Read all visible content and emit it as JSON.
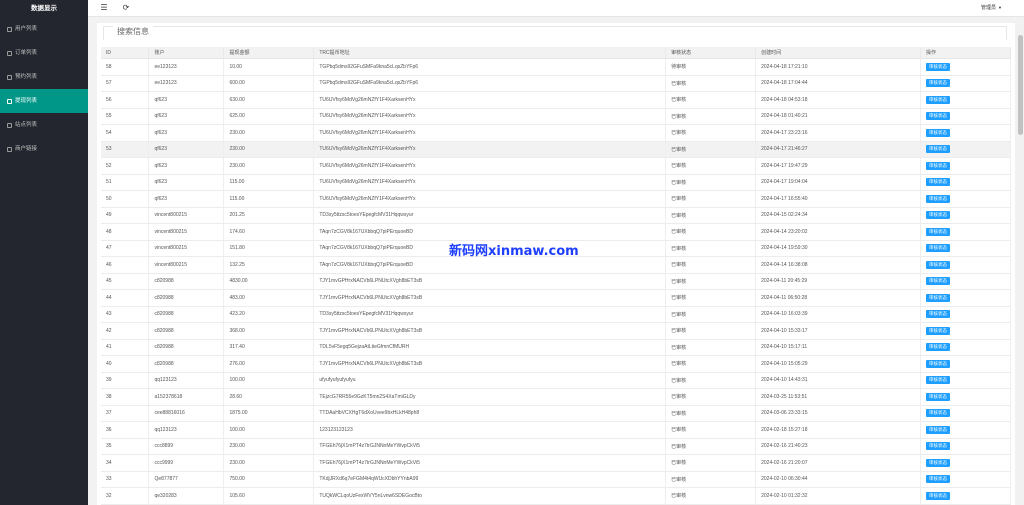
{
  "sidebar": {
    "brand": "数据显示",
    "items": [
      {
        "label": "用户列表",
        "active": false
      },
      {
        "label": "订单列表",
        "active": false
      },
      {
        "label": "预约列表",
        "active": false
      },
      {
        "label": "提现列表",
        "active": true
      },
      {
        "label": "站点列表",
        "active": false
      },
      {
        "label": "商户链接",
        "active": false
      }
    ]
  },
  "header": {
    "menu_icon": "menu-icon",
    "refresh_icon": "refresh-icon",
    "user_label": "管理员",
    "caret": "▼"
  },
  "search": {
    "title": "搜索信息"
  },
  "table": {
    "columns": [
      "ID",
      "账户",
      "提现金额",
      "TRC提币地址",
      "审核状态",
      "创建时间",
      "操作"
    ],
    "action_label": "审核状态",
    "rows": [
      [
        "58",
        "ee123123",
        "10.00",
        "TGPbq5dms92GFuSMFa9kna5cLqsZbYFp6",
        "待审核",
        "2024-04-18 17:21:10"
      ],
      [
        "57",
        "ee123123",
        "600.00",
        "TGPbq5dms92GFuSMFa9kna5cLqsZbYFp6",
        "已审核",
        "2024-04-18 17:04:44"
      ],
      [
        "56",
        "qf623",
        "630.00",
        "TU6UVfsy6MdVg26mNZfY1F4XarksenHYx",
        "已审核",
        "2024-04-18 04:53:18"
      ],
      [
        "55",
        "qf623",
        "625.00",
        "TU6UVfsy6MdVg26mNZfY1F4XarksenHYx",
        "已审核",
        "2024-04-18 01:40:21"
      ],
      [
        "54",
        "qf623",
        "230.00",
        "TU6UVfsy6MdVg26mNZfY1F4XarksenHYx",
        "已审核",
        "2024-04-17 23:23:16"
      ],
      [
        "53",
        "qf623",
        "230.00",
        "TU6UVfsy6MdVg26mNZfY1F4XarksenHYx",
        "已审核",
        "2024-04-17 21:46:27"
      ],
      [
        "52",
        "qf623",
        "230.00",
        "TU6UVfsy6MdVg26mNZfY1F4XarksenHYx",
        "已审核",
        "2024-04-17 19:47:29"
      ],
      [
        "51",
        "qf623",
        "115.00",
        "TU6UVfsy6MdVg26mNZfY1F4XarksenHYx",
        "已审核",
        "2024-04-17 19:04:04"
      ],
      [
        "50",
        "qf623",
        "115.00",
        "TU6UVfsy6MdVg26mNZfY1F4XarksenHYx",
        "已审核",
        "2024-04-17 16:55:40"
      ],
      [
        "49",
        "vincent800215",
        "201.25",
        "TD3sy5ttzsc5toesYEpegfcMV31Hqqwsyur",
        "已审核",
        "2024-04-15 02:24:34"
      ],
      [
        "48",
        "vincent800215",
        "174.60",
        "TAqn7zCGV8k167UXbbqQ7piPErquoeBD",
        "已审核",
        "2024-04-14 23:20:02"
      ],
      [
        "47",
        "vincent800215",
        "151.80",
        "TAqn7zCGV8k167UXbbqQ7piPErquoeBD",
        "已审核",
        "2024-04-14 19:59:30"
      ],
      [
        "46",
        "vincent800215",
        "132.25",
        "TAqn7zCGV8k167UXbbqQ7piPErquoeBD",
        "已审核",
        "2024-04-14 16:38:08"
      ],
      [
        "45",
        "c820988",
        "4830.00",
        "TJY1mvGPHrxNACVb6LPNUtcXVgh8bET3sB",
        "已审核",
        "2024-04-11 20:45:29"
      ],
      [
        "44",
        "c820988",
        "483.00",
        "TJY1mvGPHrxNACVb6LPNUtcXVgh8bET3sB",
        "已审核",
        "2024-04-11 06:50:28"
      ],
      [
        "43",
        "c820988",
        "423.20",
        "TD3sy5ttzsc5toesYEpegfcMV31Hqqwsyur",
        "已审核",
        "2024-04-10 16:03:39"
      ],
      [
        "42",
        "c820988",
        "368.00",
        "TJY1mvGPHrxNACVb6LPNUtcXVgh8bET3sB",
        "已审核",
        "2024-04-10 15:33:17"
      ],
      [
        "41",
        "c820988",
        "317.40",
        "TDL5vF5egq5GejzaAtLtieGfmnCfMURH",
        "已审核",
        "2024-04-10 15:17:11"
      ],
      [
        "40",
        "c820988",
        "276.00",
        "TJY1mvGPHrxNACVb6LPNUtcXVgh8bET3sB",
        "已审核",
        "2024-04-10 15:05:29"
      ],
      [
        "39",
        "qq123123",
        "100.00",
        "ufyufyufyufyufyu",
        "已审核",
        "2024-04-10 14:43:31"
      ],
      [
        "38",
        "a152378618",
        "28.60",
        "TEjzcG7RR55e9GzKT5mn2S4XaTmiGLDy",
        "已审核",
        "2024-03-25 11:53:51"
      ],
      [
        "37",
        "cee88816016",
        "1875.00",
        "TTDAaHbVCXHgT6dXoUvee9bxHLkH48ph8",
        "已审核",
        "2024-03-06 23:33:15"
      ],
      [
        "36",
        "qq123123",
        "100.00",
        "123123123123",
        "已审核",
        "2024-02-18 15:27:18"
      ],
      [
        "35",
        "ccc8899",
        "230.00",
        "TFGEh76jX1mPT4z7trGJNNnMeYWvpCkVi5",
        "已审核",
        "2024-02-16 21:40:23"
      ],
      [
        "34",
        "ccc9999",
        "230.00",
        "TFGEh76jX1mPT4z7trGJNNnMeYWvpCkVi5",
        "已审核",
        "2024-02-16 21:20:07"
      ],
      [
        "33",
        "Qe877877",
        "750.00",
        "TKdjJRXd6q7eFGM4t4qWUcXDbhYYnbA99",
        "已审核",
        "2024-02-10 06:30:44"
      ],
      [
        "32",
        "qe320283",
        "105.60",
        "TUQkWCLqoUzFexWVY5nLvnw6SDEGocBto",
        "已审核",
        "2024-02-10 01:32:32"
      ]
    ]
  },
  "watermark": "新码网xinmaw.com"
}
